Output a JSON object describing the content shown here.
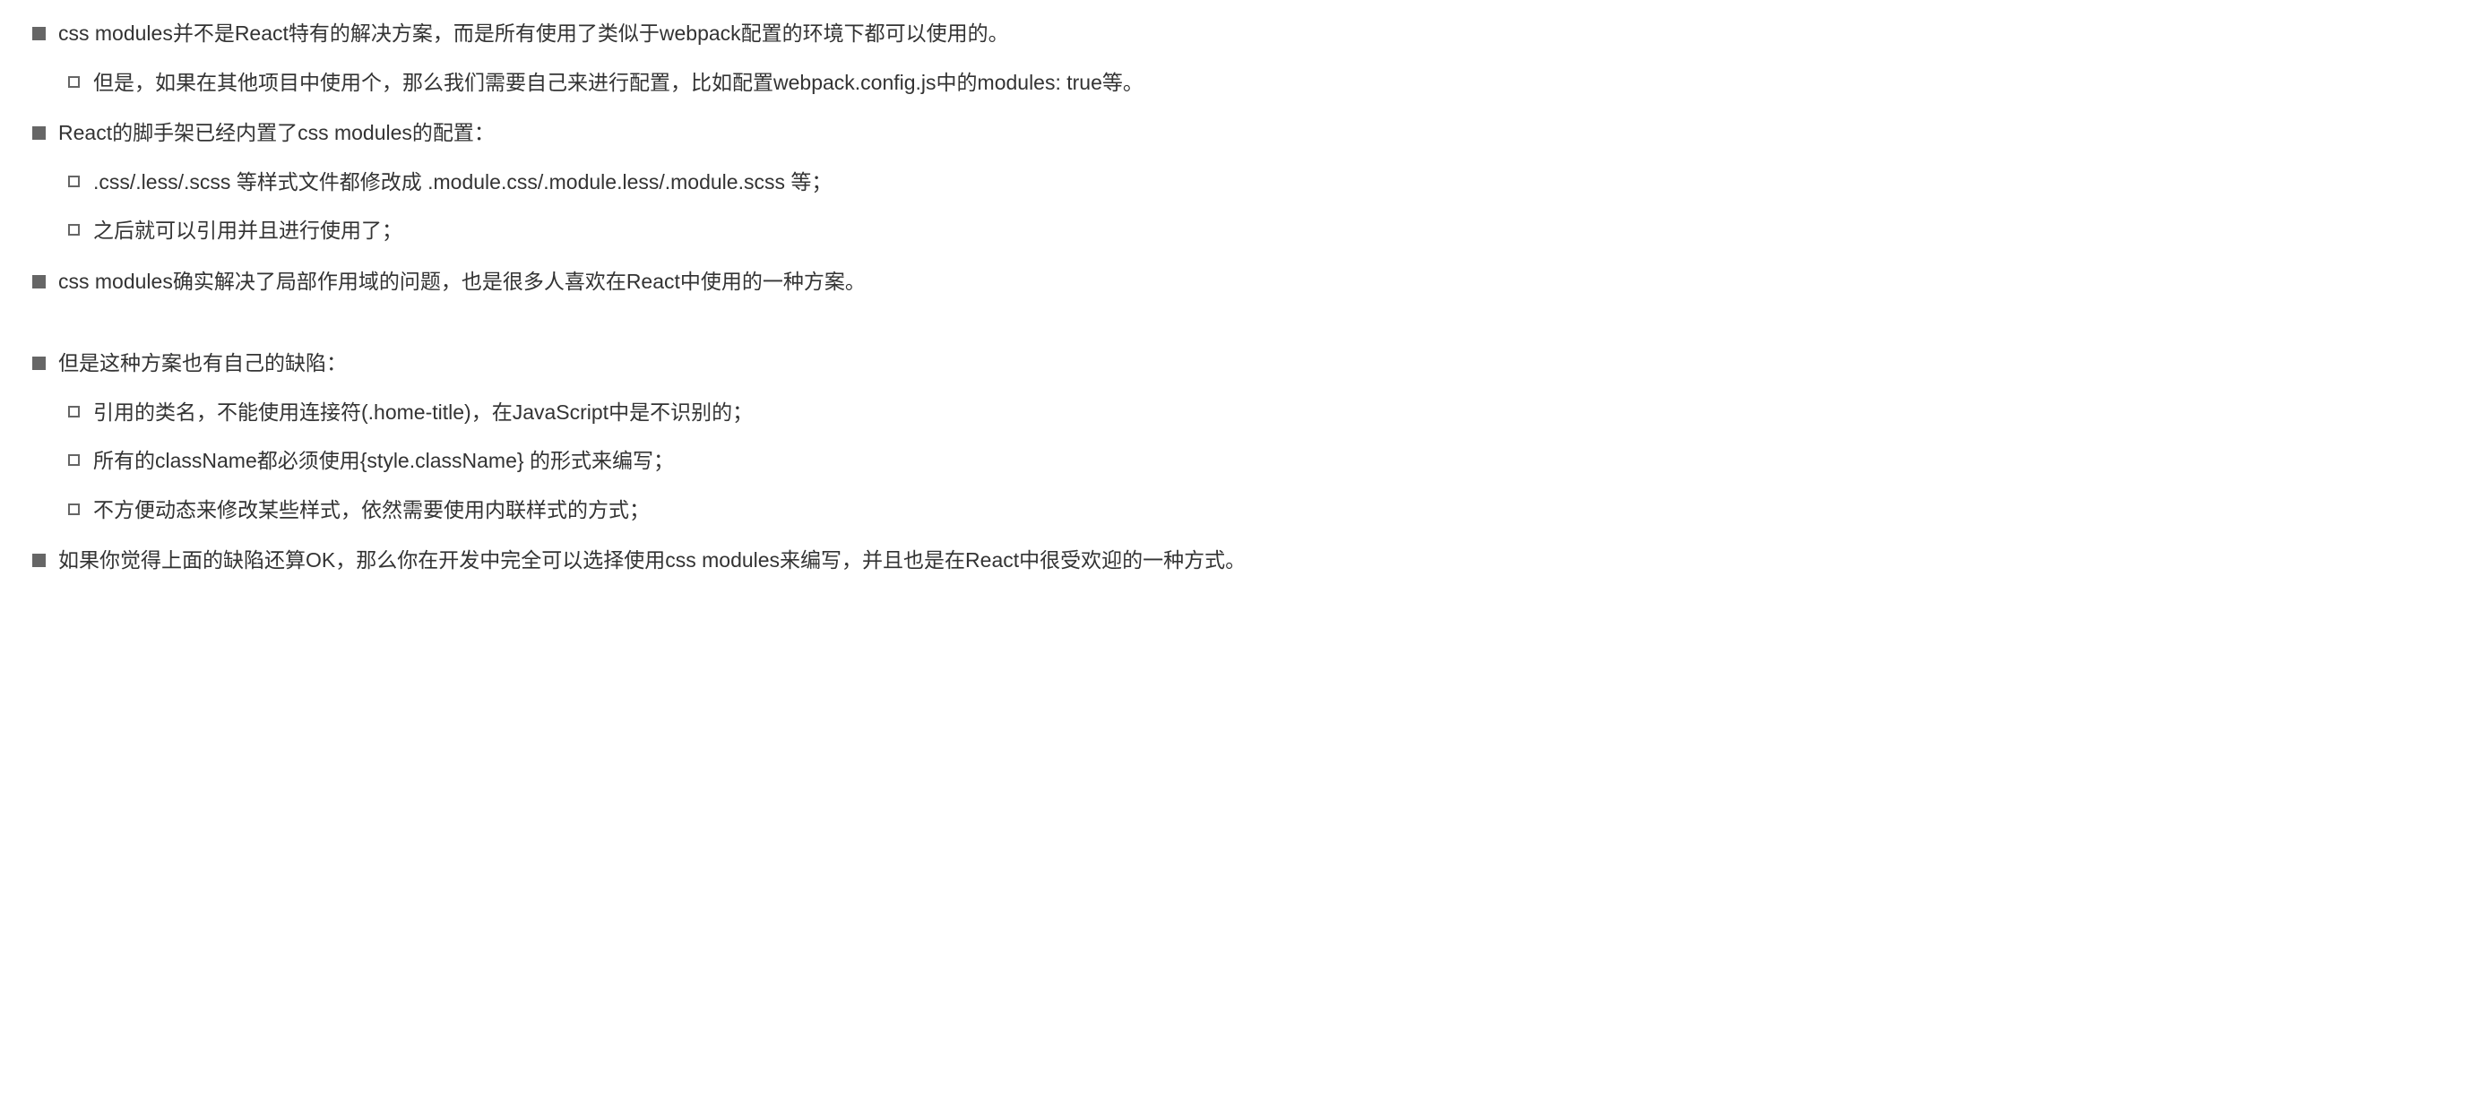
{
  "section1": {
    "item1": {
      "text": "css modules并不是React特有的解决方案，而是所有使用了类似于webpack配置的环境下都可以使用的。",
      "sub": [
        "但是，如果在其他项目中使用个，那么我们需要自己来进行配置，比如配置webpack.config.js中的modules: true等。"
      ]
    },
    "item2": {
      "text": "React的脚手架已经内置了css modules的配置：",
      "sub": [
        ".css/.less/.scss 等样式文件都修改成 .module.css/.module.less/.module.scss 等；",
        "之后就可以引用并且进行使用了；"
      ]
    },
    "item3": {
      "text": "css modules确实解决了局部作用域的问题，也是很多人喜欢在React中使用的一种方案。"
    }
  },
  "section2": {
    "item1": {
      "text": "但是这种方案也有自己的缺陷：",
      "sub": [
        "引用的类名，不能使用连接符(.home-title)，在JavaScript中是不识别的；",
        "所有的className都必须使用{style.className} 的形式来编写；",
        "不方便动态来修改某些样式，依然需要使用内联样式的方式；"
      ]
    },
    "item2": {
      "text": "如果你觉得上面的缺陷还算OK，那么你在开发中完全可以选择使用css modules来编写，并且也是在React中很受欢迎的一种方式。"
    }
  }
}
